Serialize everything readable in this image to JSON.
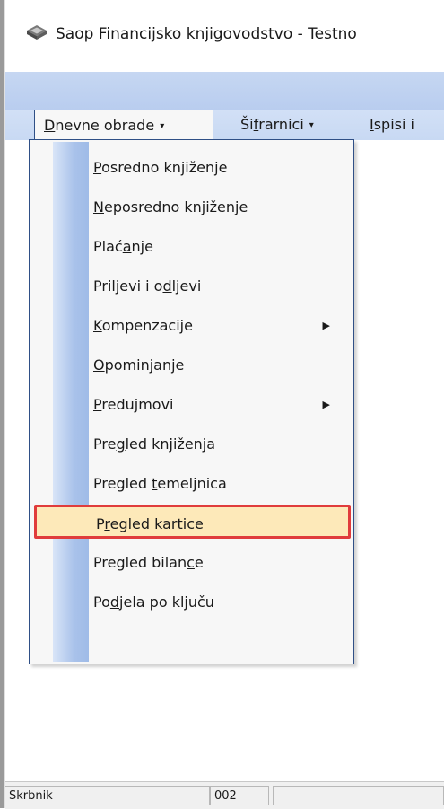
{
  "window": {
    "title": "Saop Financijsko knjigovodstvo - Testno"
  },
  "menubar": {
    "items": [
      {
        "pre": "",
        "u": "D",
        "post": "nevne obrade",
        "arrow": "▾"
      },
      {
        "pre": "Ši",
        "u": "f",
        "post": "rarnici",
        "arrow": "▾"
      },
      {
        "pre": "",
        "u": "I",
        "post": "spisi i",
        "arrow": ""
      }
    ]
  },
  "dropdown": {
    "items": [
      {
        "pre": "",
        "u": "P",
        "post": "osredno knjiženje",
        "submenu": ""
      },
      {
        "pre": "",
        "u": "N",
        "post": "eposredno knjiženje",
        "submenu": ""
      },
      {
        "pre": "Plać",
        "u": "a",
        "post": "nje",
        "submenu": ""
      },
      {
        "pre": "Priljevi i o",
        "u": "d",
        "post": "ljevi",
        "submenu": ""
      },
      {
        "pre": "",
        "u": "K",
        "post": "ompenzacije",
        "submenu": "▶"
      },
      {
        "pre": "",
        "u": "O",
        "post": "pominjanje",
        "submenu": ""
      },
      {
        "pre": "",
        "u": "P",
        "post": "redujmovi",
        "submenu": "▶"
      },
      {
        "pre": "Pre",
        "u": "g",
        "post": "led knjiženja",
        "submenu": ""
      },
      {
        "pre": "Pregled ",
        "u": "t",
        "post": "emeljnica",
        "submenu": ""
      },
      {
        "pre": "P",
        "u": "r",
        "post": "egled kartice",
        "submenu": ""
      },
      {
        "pre": "Pregled bilan",
        "u": "c",
        "post": "e",
        "submenu": ""
      },
      {
        "pre": "Po",
        "u": "d",
        "post": "jela po ključu",
        "submenu": ""
      }
    ]
  },
  "statusbar": {
    "user": "Skrbnik",
    "code": "002"
  },
  "colors": {
    "selection_fill": "#fde9b9",
    "selection_border": "#e03c3c",
    "menu_border": "#2f4f86"
  }
}
